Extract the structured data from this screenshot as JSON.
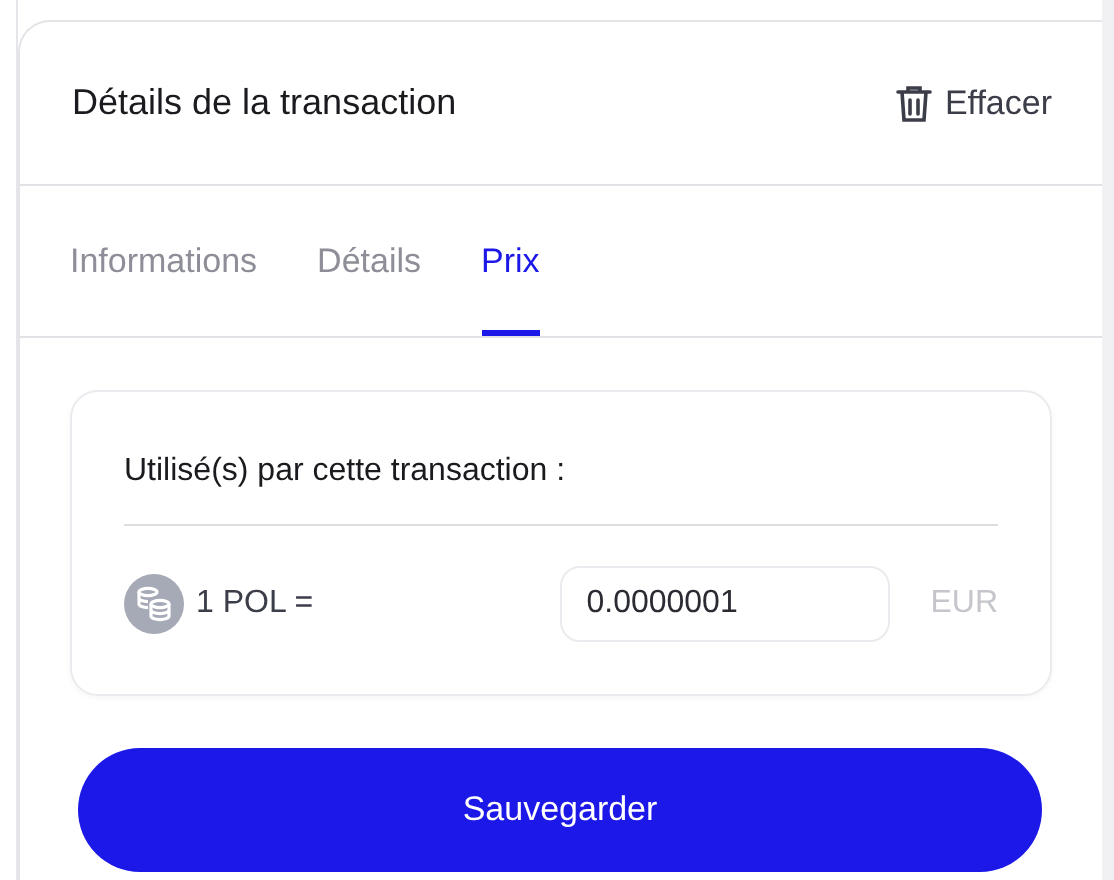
{
  "header": {
    "title": "Détails de la transaction",
    "clear_button": "Effacer"
  },
  "tabs": [
    {
      "label": "Informations",
      "selected": false
    },
    {
      "label": "Détails",
      "selected": false
    },
    {
      "label": "Prix",
      "selected": true
    }
  ],
  "price_card": {
    "heading": "Utilisé(s) par cette transaction :",
    "rate_label": "1 POL =",
    "value": "0.0000001",
    "currency": "EUR"
  },
  "save_button": "Sauvegarder"
}
